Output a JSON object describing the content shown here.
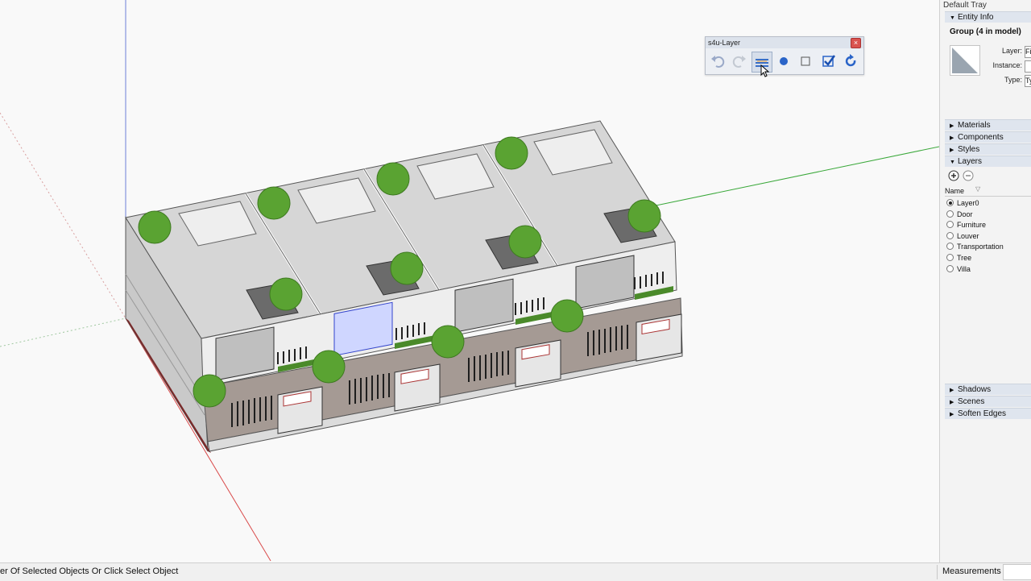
{
  "viewport": {
    "axis_colors": {
      "red": "#d94a4a",
      "green": "#3aa83a",
      "blue": "#6d7fd6"
    }
  },
  "s4u_toolbar": {
    "title": "s4u-Layer",
    "close_glyph": "×",
    "buttons": [
      {
        "name": "undo-icon"
      },
      {
        "name": "redo-icon"
      },
      {
        "name": "layers-icon"
      },
      {
        "name": "circle-icon"
      },
      {
        "name": "square-icon"
      },
      {
        "name": "check-icon"
      },
      {
        "name": "refresh-icon"
      }
    ]
  },
  "tray": {
    "title": "Default Tray",
    "entity_info": {
      "header": "Entity Info",
      "title": "Group (4 in model)",
      "layer_label": "Layer:",
      "layer_value": "Fi",
      "instance_label": "Instance:",
      "instance_value": "",
      "type_label": "Type:",
      "type_value": "Ty"
    },
    "panels": {
      "materials": "Materials",
      "components": "Components",
      "styles": "Styles",
      "layers": "Layers",
      "shadows": "Shadows",
      "scenes": "Scenes",
      "soften_edges": "Soften Edges"
    },
    "layers_panel": {
      "column_name": "Name",
      "items": [
        "Layer0",
        "Door",
        "Furniture",
        "Louver",
        "Transportation",
        "Tree",
        "Villa"
      ],
      "active": "Layer0"
    }
  },
  "status_bar": {
    "message": "er Of Selected Objects Or Click Select Object",
    "measurements_label": "Measurements",
    "measurements_value": ""
  }
}
